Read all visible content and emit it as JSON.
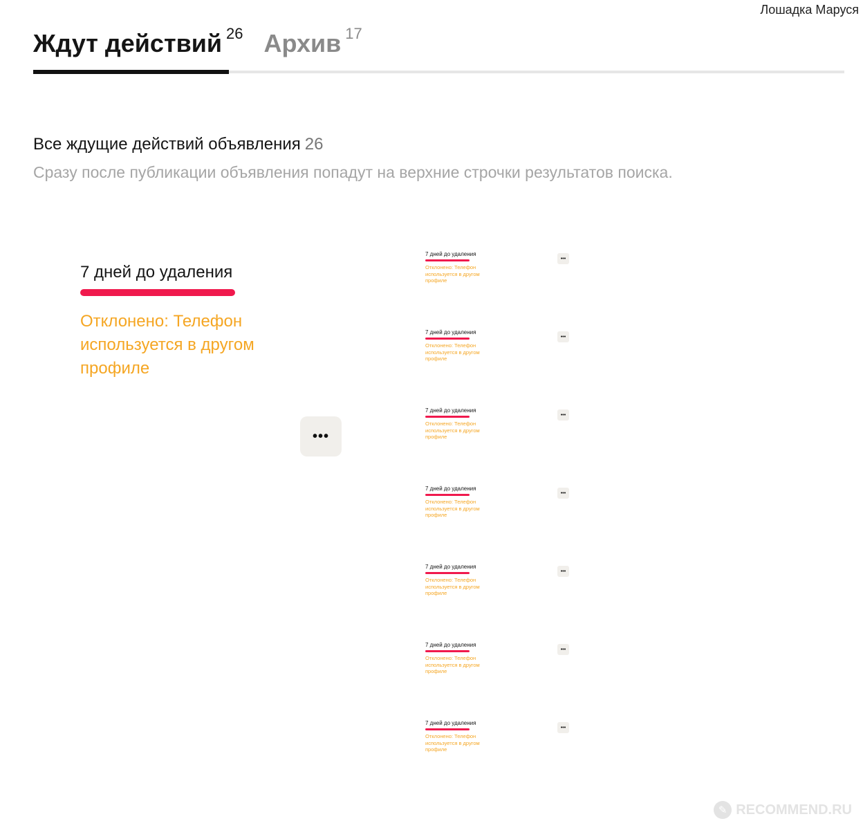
{
  "username": "Лошадка Маруся",
  "tabs": [
    {
      "label": "Ждут действий",
      "count": "26"
    },
    {
      "label": "Архив",
      "count": "17"
    }
  ],
  "section": {
    "title": "Все ждущие действий объявления",
    "count": "26",
    "subtitle": "Сразу после публикации объявления попадут на верхние строчки результатов поиска."
  },
  "ad": {
    "status": "7 дней до удаления",
    "reason": "Отклонено: Телефон используется в другом профиле",
    "menu": "•••"
  },
  "list": [
    {
      "status": "7 дней до удаления",
      "reason": "Отклонено: Телефон используется в другом профиле",
      "menu": "•••"
    },
    {
      "status": "7 дней до удаления",
      "reason": "Отклонено: Телефон используется в другом профиле",
      "menu": "•••"
    },
    {
      "status": "7 дней до удаления",
      "reason": "Отклонено: Телефон используется в другом профиле",
      "menu": "•••"
    },
    {
      "status": "7 дней до удаления",
      "reason": "Отклонено: Телефон используется в другом профиле",
      "menu": "•••"
    },
    {
      "status": "7 дней до удаления",
      "reason": "Отклонено: Телефон используется в другом профиле",
      "menu": "•••"
    },
    {
      "status": "7 дней до удаления",
      "reason": "Отклонено: Телефон используется в другом профиле",
      "menu": "•••"
    },
    {
      "status": "7 дней до удаления",
      "reason": "Отклонено: Телефон используется в другом профиле",
      "menu": "•••"
    }
  ],
  "watermark": "RECOMMEND.RU",
  "colors": {
    "accent_red": "#f0194d",
    "warning_orange": "#f5a623"
  }
}
